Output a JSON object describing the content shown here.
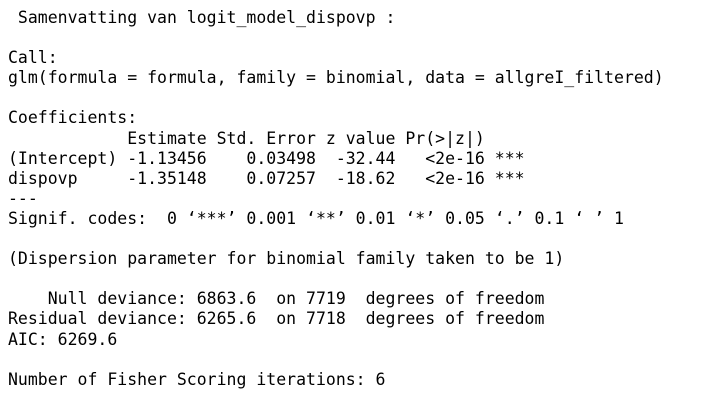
{
  "console": {
    "title": " Samenvatting van logit_model_dispovp :",
    "call_label": "Call:",
    "call_text": "glm(formula = formula, family = binomial, data = allgreI_filtered)",
    "coef_label": "Coefficients:",
    "coef_header": "            Estimate Std. Error z value Pr(>|z|)",
    "coef_rows": [
      "(Intercept) -1.13456    0.03498  -32.44   <2e-16 ***",
      "dispovp     -1.35148    0.07257  -18.62   <2e-16 ***"
    ],
    "separator": "---",
    "signif_codes": "Signif. codes:  0 ‘***’ 0.001 ‘**’ 0.01 ‘*’ 0.05 ‘.’ 0.1 ‘ ’ 1",
    "dispersion": "(Dispersion parameter for binomial family taken to be 1)",
    "null_deviance": "    Null deviance: 6863.6  on 7719  degrees of freedom",
    "residual_deviance": "Residual deviance: 6265.6  on 7718  degrees of freedom",
    "aic": "AIC: 6269.6",
    "fisher_iterations": "Number of Fisher Scoring iterations: 6"
  }
}
